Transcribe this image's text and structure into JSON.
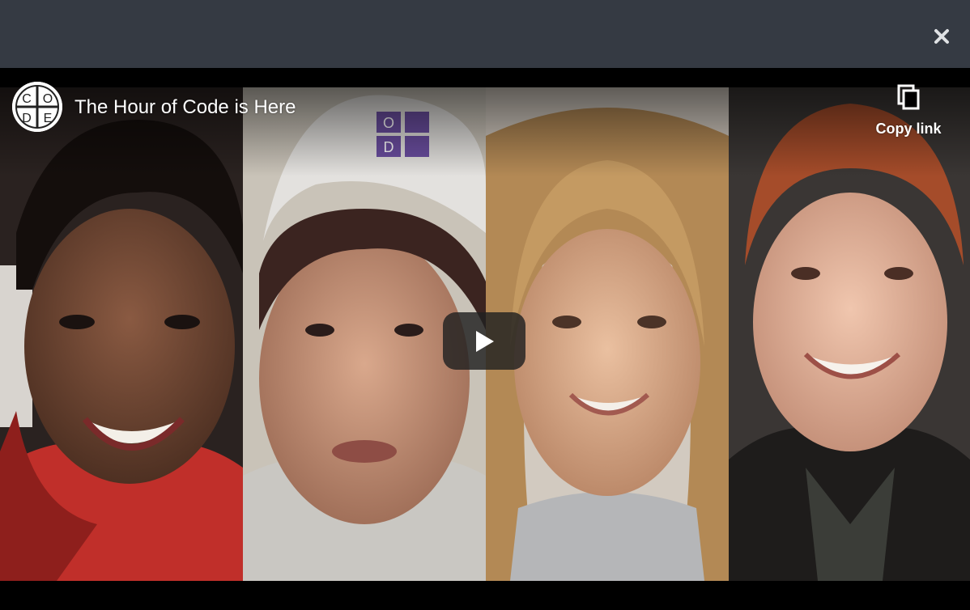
{
  "modal": {
    "close_icon": "close-icon",
    "header_color": "#353a43"
  },
  "video": {
    "title": "The Hour of Code is Here",
    "channel_logo": {
      "letters": [
        "C",
        "O",
        "D",
        "E"
      ],
      "icon": "code-org-logo"
    },
    "copy_link": {
      "label": "Copy link",
      "icon": "copy-icon"
    },
    "play_icon": "play-icon",
    "panels": [
      {
        "name": "person-panel-1",
        "background": "#2a2220",
        "clothing": "#c02f2a"
      },
      {
        "name": "person-panel-2",
        "background": "#c9c3b8",
        "clothing": "#c9c7c2",
        "cap_text": [
          "O",
          "D"
        ]
      },
      {
        "name": "person-panel-3",
        "background": "#d2cac0",
        "clothing": "#b5b6b8"
      },
      {
        "name": "person-panel-4",
        "background": "#3a3634",
        "clothing": "#1e1c1b"
      }
    ]
  }
}
